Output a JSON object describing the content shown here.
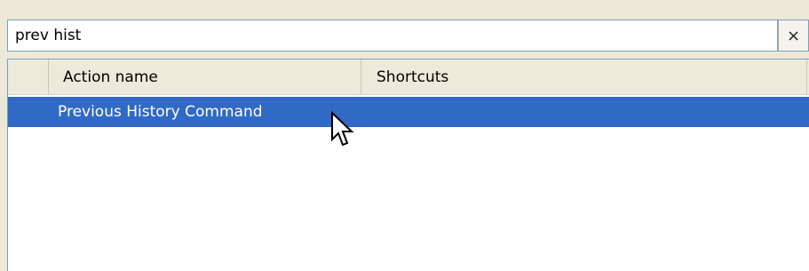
{
  "search": {
    "value": "prev hist",
    "clear_label": "×"
  },
  "table": {
    "columns": [
      "Action name",
      "Shortcuts"
    ],
    "rows": [
      {
        "action": "Previous History Command",
        "shortcut": "",
        "selected": true
      }
    ]
  },
  "colors": {
    "selection": "#316ac5",
    "header_bg": "#ebeadb",
    "window_bg": "#ece9d8"
  },
  "icons": {
    "cursor": "mouse-pointer-icon"
  }
}
